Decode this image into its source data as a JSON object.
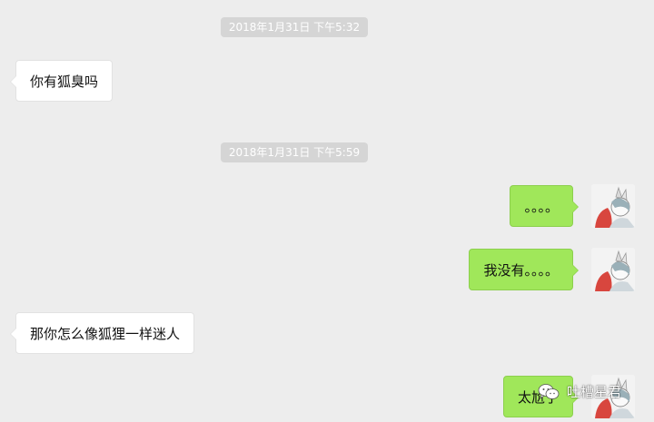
{
  "chat": {
    "messages": [
      {
        "type": "timestamp",
        "text": "2018年1月31日 下午5:32"
      },
      {
        "type": "received",
        "text": "你有狐臭吗"
      },
      {
        "type": "timestamp",
        "text": "2018年1月31日 下午5:59"
      },
      {
        "type": "sent",
        "text": "。。。。"
      },
      {
        "type": "sent",
        "text": "我没有。。。。"
      },
      {
        "type": "received",
        "text": "那你怎么像狐狸一样迷人"
      },
      {
        "type": "sent",
        "text": "太尬了"
      }
    ]
  },
  "watermark": {
    "text": "吐槽星君",
    "icon": "wechat-icon"
  },
  "colors": {
    "background": "#ededed",
    "sent_bubble": "#a0e75a",
    "received_bubble": "#ffffff",
    "timestamp_bg": "#d5d5d5"
  }
}
